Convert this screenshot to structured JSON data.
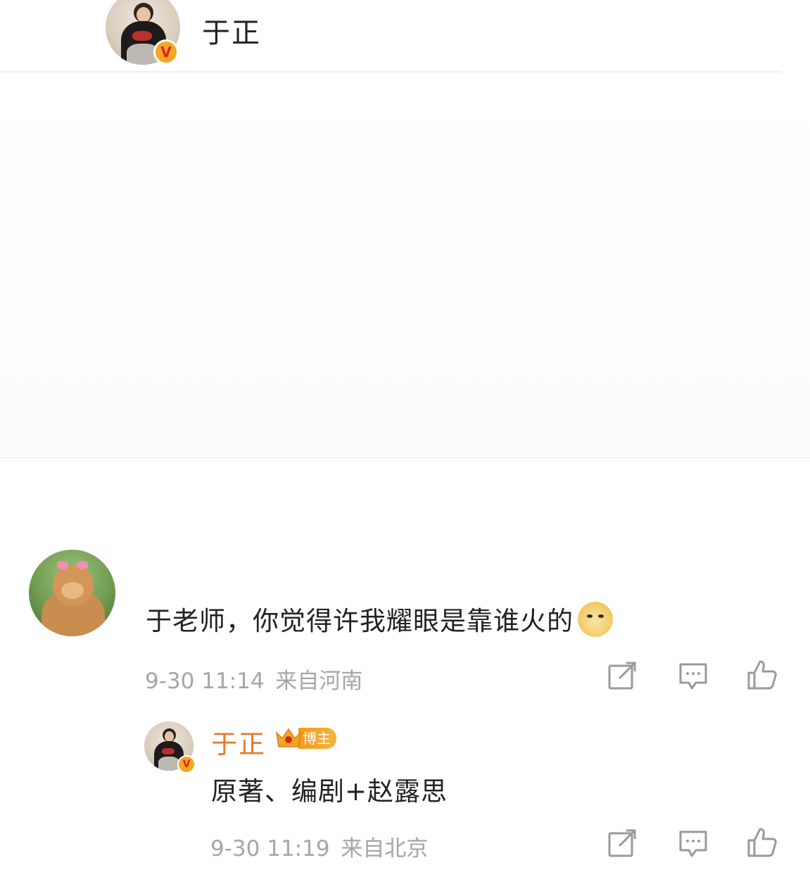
{
  "header": {
    "author_name": "于正"
  },
  "comment": {
    "text": "于老师，你觉得许我耀眼是靠谁火的",
    "emoji": "doge",
    "date": "9-30",
    "time": "11:14",
    "location": "来自河南",
    "actions": [
      "share-icon",
      "comment-icon",
      "like-icon"
    ]
  },
  "reply": {
    "author_name": "于正",
    "badge": "博主",
    "text": "原著、编剧+赵露思",
    "date": "9-30",
    "time": "11:19",
    "location": "来自北京",
    "actions": [
      "share-icon",
      "comment-icon",
      "like-icon"
    ]
  },
  "colors": {
    "author_highlight": "#e8792b",
    "meta_text": "#a6a6a6",
    "badge_orange": "#f39a1e",
    "verified_badge": "#f5a623"
  }
}
